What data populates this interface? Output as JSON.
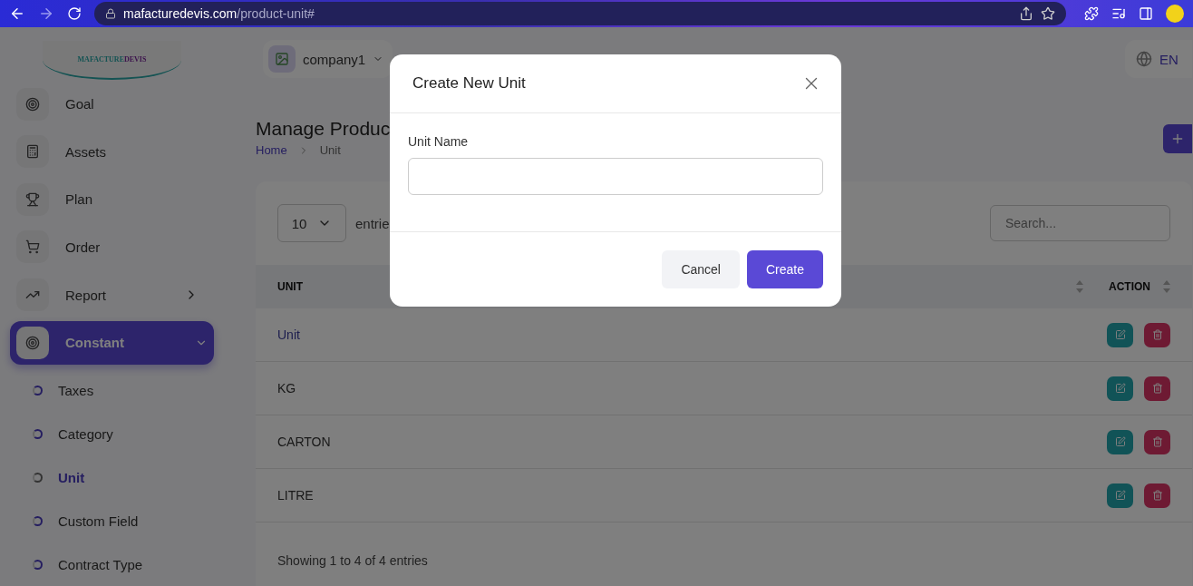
{
  "browser": {
    "url_host": "mafacturedevis.com",
    "url_path": "/product-unit#"
  },
  "logo": {
    "part_1": "MAFACTURE",
    "part_2": "DEVIS"
  },
  "header": {
    "company": "company1",
    "language": "EN"
  },
  "sidebar": {
    "items": [
      {
        "label": "Goal",
        "selected": false
      },
      {
        "label": "Assets",
        "selected": false
      },
      {
        "label": "Plan",
        "selected": false
      },
      {
        "label": "Order",
        "selected": false
      },
      {
        "label": "Report",
        "selected": false,
        "expanded": false
      },
      {
        "label": "Constant",
        "selected": true,
        "expanded": true,
        "children": [
          {
            "label": "Taxes",
            "selected": false
          },
          {
            "label": "Category",
            "selected": false
          },
          {
            "label": "Unit",
            "selected": true
          },
          {
            "label": "Custom Field",
            "selected": false
          },
          {
            "label": "Contract Type",
            "selected": false
          }
        ]
      }
    ]
  },
  "page": {
    "title": "Manage Produc",
    "breadcrumb": [
      {
        "label": "Home",
        "kind": "link"
      },
      {
        "label": "Unit",
        "kind": "current"
      }
    ]
  },
  "table": {
    "page_size": "10",
    "entries_label": "entrie",
    "search": {
      "placeholder": "Search..."
    },
    "columns": [
      "UNIT",
      "ACTION"
    ],
    "rows": [
      {
        "unit": "Unit"
      },
      {
        "unit": "KG"
      },
      {
        "unit": "CARTON"
      },
      {
        "unit": "LITRE"
      }
    ],
    "footer": "Showing 1 to 4 of 4 entries"
  },
  "modal": {
    "title": "Create New Unit",
    "field": {
      "label": "Unit Name"
    },
    "buttons": [
      {
        "label": "Cancel",
        "kind": "secondary"
      },
      {
        "label": "Create",
        "kind": "primary"
      }
    ]
  }
}
